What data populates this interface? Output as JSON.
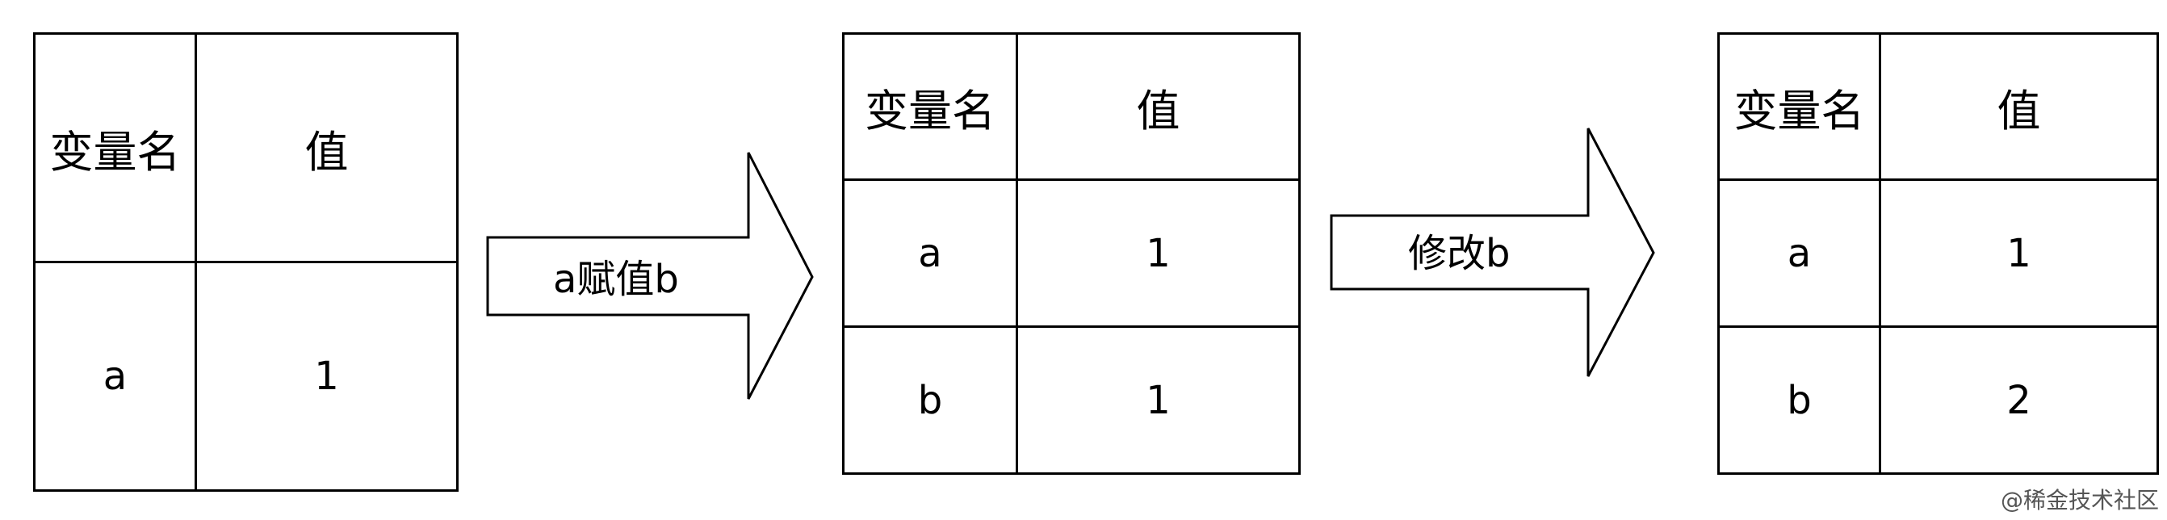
{
  "tables": [
    {
      "header": {
        "name": "变量名",
        "value": "值"
      },
      "rows": [
        {
          "name": "a",
          "value": "1"
        }
      ]
    },
    {
      "header": {
        "name": "变量名",
        "value": "值"
      },
      "rows": [
        {
          "name": "a",
          "value": "1"
        },
        {
          "name": "b",
          "value": "1"
        }
      ]
    },
    {
      "header": {
        "name": "变量名",
        "value": "值"
      },
      "rows": [
        {
          "name": "a",
          "value": "1"
        },
        {
          "name": "b",
          "value": "2"
        }
      ]
    }
  ],
  "arrows": [
    {
      "label": "a赋值b"
    },
    {
      "label": "修改b"
    }
  ],
  "watermark": "@稀金技术社区"
}
